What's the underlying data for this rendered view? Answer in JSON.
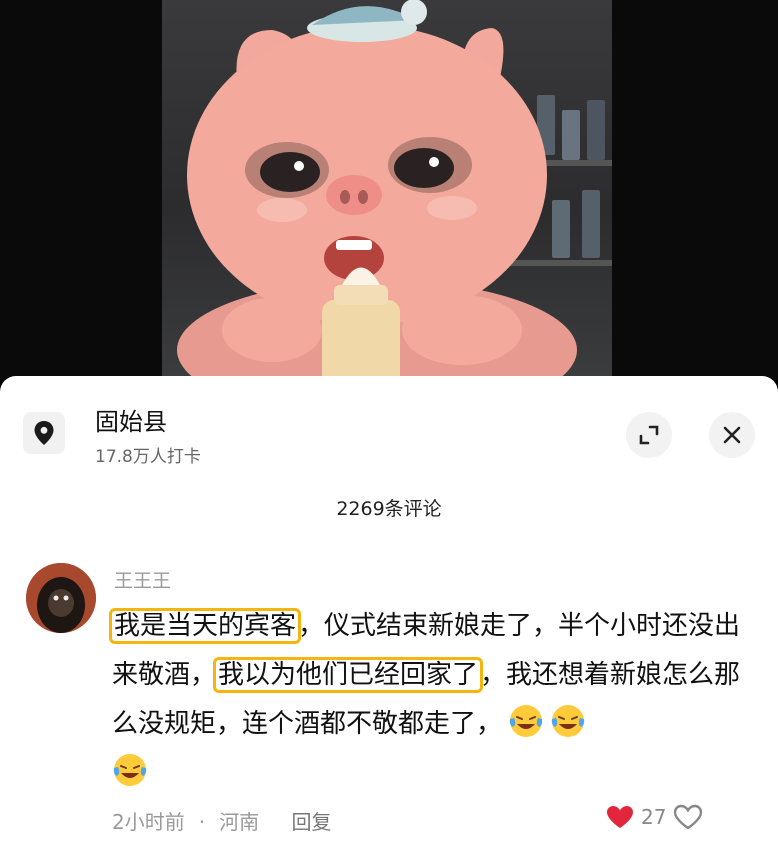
{
  "location": {
    "name": "固始县",
    "checkins": "17.8万人打卡"
  },
  "comments_header": {
    "count_label": "2269条评论"
  },
  "comment": {
    "username": "王王王",
    "highlight_1": "我是当天的宾客",
    "text_1": "，仪式结束新娘走了，半个小时还没出来敬酒，",
    "highlight_2": "我以为他们已经回家了",
    "text_2": "，我还想着新娘怎么那么没规矩，连个酒都不敬都走了，",
    "time": "2小时前",
    "region": "河南",
    "reply_label": "回复",
    "like_count": "27",
    "emoji": "laughing-crying"
  },
  "colors": {
    "highlight": "#f4b60d",
    "sheet_bg": "#ffffff"
  }
}
